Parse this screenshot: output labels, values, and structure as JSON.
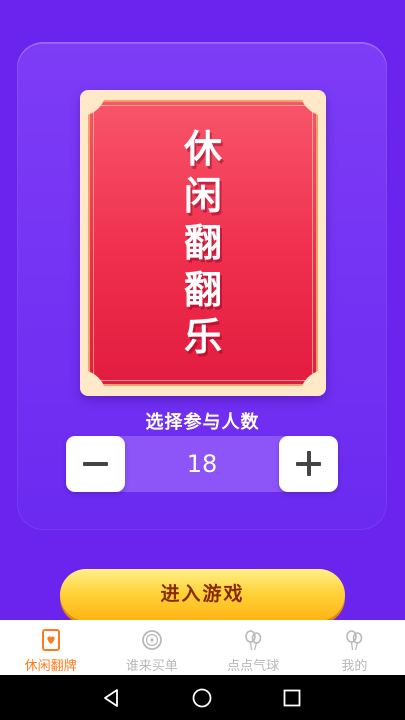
{
  "card": {
    "title_chars": [
      "休",
      "闲",
      "翻",
      "翻",
      "乐"
    ]
  },
  "selector": {
    "label": "选择参与人数",
    "count": "18"
  },
  "start_button": {
    "label": "进入游戏"
  },
  "tabs": [
    {
      "label": "休闲翻牌",
      "icon": "card-icon",
      "active": true
    },
    {
      "label": "谁来买单",
      "icon": "bottle-cap-icon",
      "active": false
    },
    {
      "label": "点点气球",
      "icon": "balloon-icon",
      "active": false
    },
    {
      "label": "我的",
      "icon": "balloon-icon",
      "active": false
    }
  ],
  "colors": {
    "background": "#6a24ee",
    "card_red": "#ef2e4c",
    "button_gold": "#ffd33a",
    "tab_active": "#ff7a1c",
    "tab_inactive": "#b8b8b8"
  }
}
